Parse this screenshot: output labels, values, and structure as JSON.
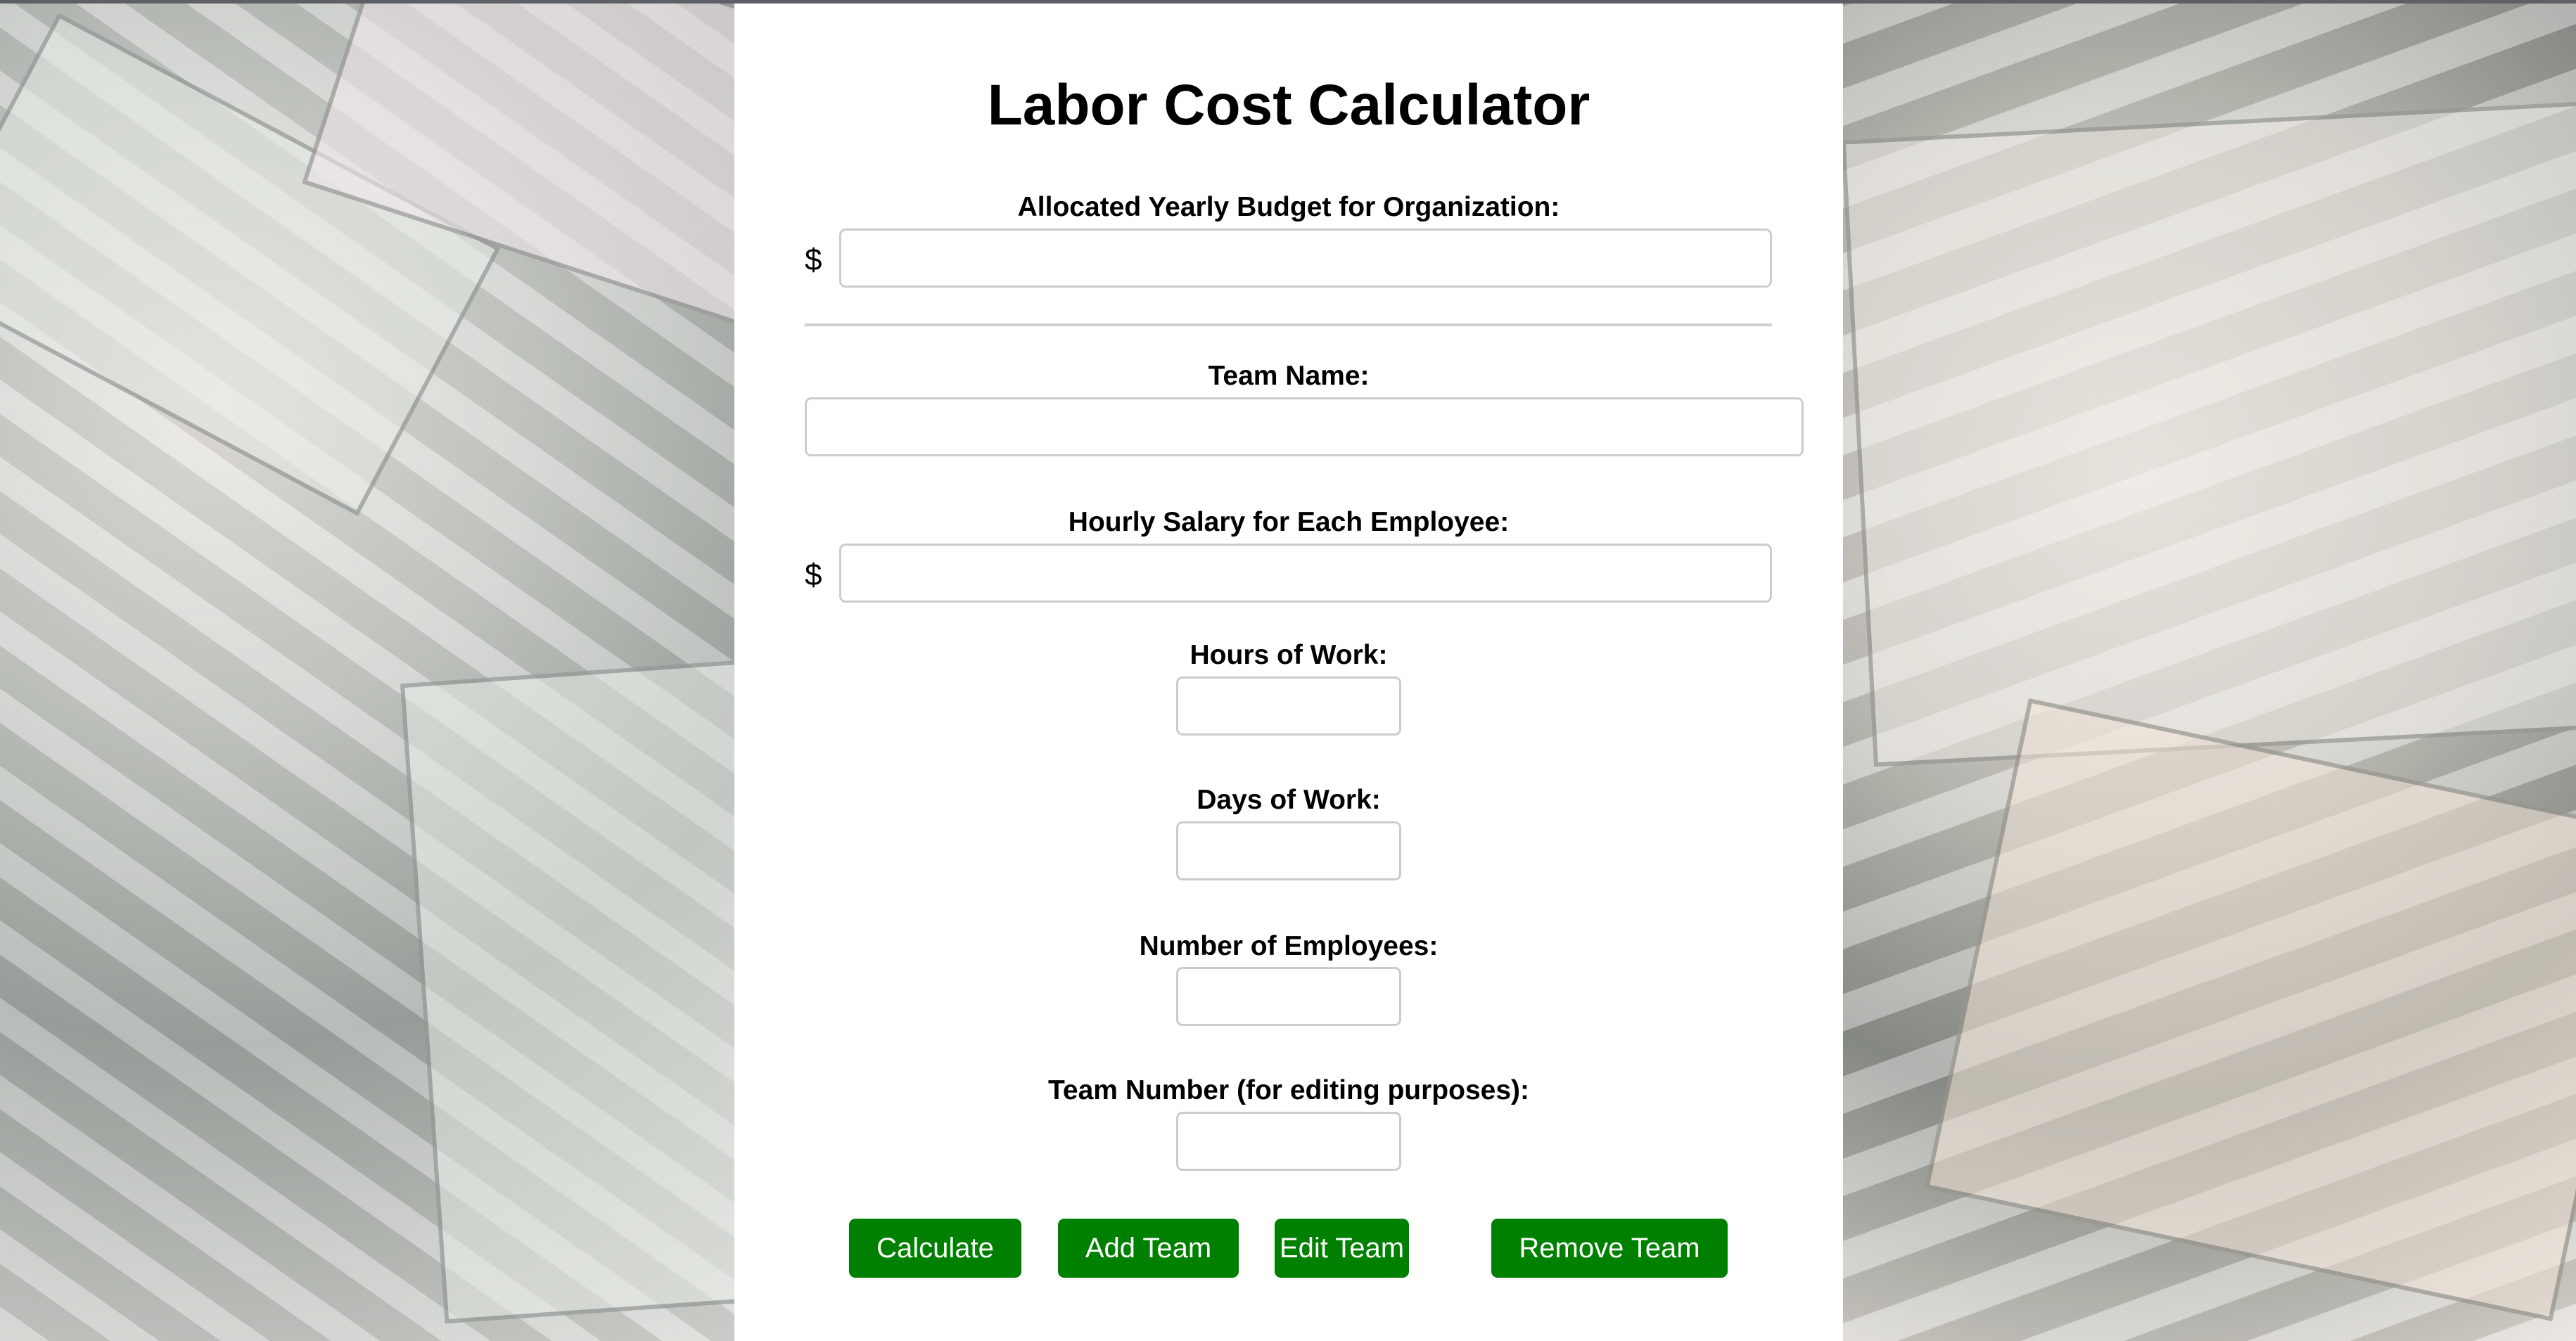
{
  "title": "Labor Cost Calculator",
  "budget": {
    "label": "Allocated Yearly Budget for Organization:",
    "currency": "$",
    "value": ""
  },
  "team_name": {
    "label": "Team Name:",
    "value": ""
  },
  "hourly_salary": {
    "label": "Hourly Salary for Each Employee:",
    "currency": "$",
    "value": ""
  },
  "hours": {
    "label": "Hours of Work:",
    "value": ""
  },
  "days": {
    "label": "Days of Work:",
    "value": ""
  },
  "employees": {
    "label": "Number of Employees:",
    "value": ""
  },
  "team_number": {
    "label": "Team Number (for editing purposes):",
    "value": ""
  },
  "buttons": {
    "calculate": "Calculate",
    "add": "Add Team",
    "edit": "Edit Team",
    "remove": "Remove Team"
  },
  "colors": {
    "button": "#008000"
  }
}
